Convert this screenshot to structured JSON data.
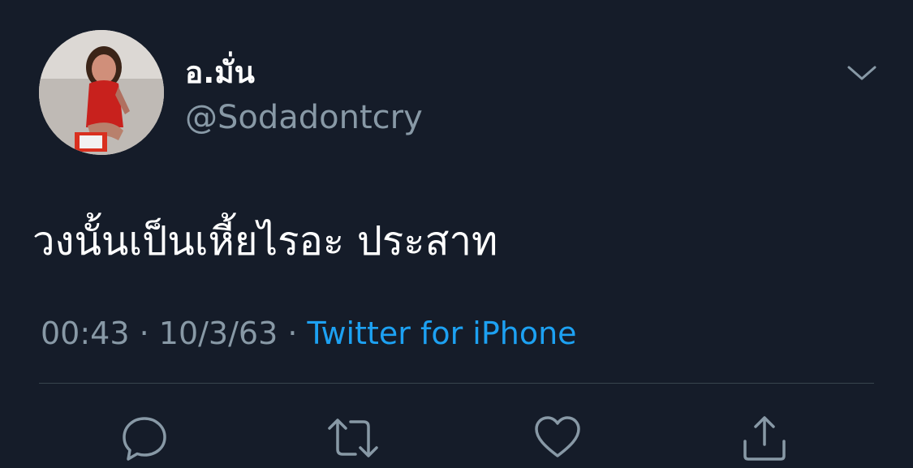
{
  "user": {
    "display_name": "อ.มั่น",
    "handle": "@Sodadontcry",
    "avatar_icon": "profile-photo"
  },
  "menu": {
    "icon": "chevron-down-icon"
  },
  "tweet": {
    "text": "วงนั้นเป็นเหี้ยไรอะ ประสาท"
  },
  "meta": {
    "time": "00:43",
    "separator1": " · ",
    "date": "10/3/63",
    "separator2": " · ",
    "source": "Twitter for iPhone"
  },
  "actions": [
    {
      "name": "reply",
      "icon": "reply-icon"
    },
    {
      "name": "retweet",
      "icon": "retweet-icon"
    },
    {
      "name": "like",
      "icon": "heart-icon"
    },
    {
      "name": "share",
      "icon": "share-icon"
    }
  ],
  "colors": {
    "background": "#151c29",
    "text_primary": "#ffffff",
    "text_secondary": "#8899a6",
    "accent": "#1da1f2",
    "divider": "#38444d"
  }
}
